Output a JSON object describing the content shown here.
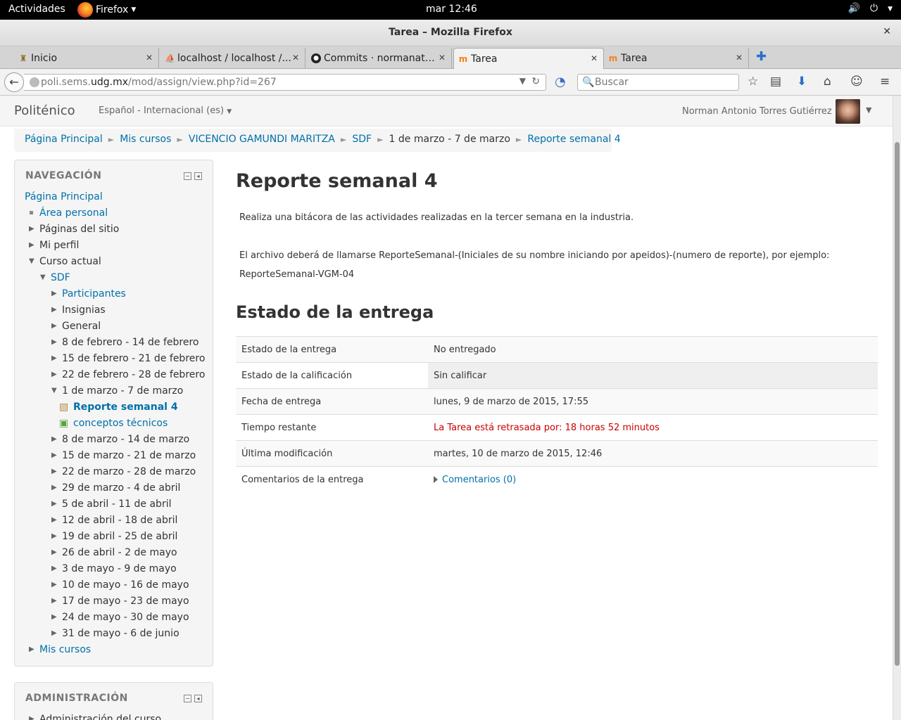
{
  "gnome": {
    "activities": "Actividades",
    "app": "Firefox",
    "clock": "mar 12:46"
  },
  "window": {
    "title": "Tarea – Mozilla Firefox"
  },
  "tabs": [
    {
      "label": "Inicio",
      "icon": "crest-icon"
    },
    {
      "label": "localhost / localhost /...",
      "icon": "phpmyadmin-icon"
    },
    {
      "label": "Commits · normanatg...",
      "icon": "github-icon"
    },
    {
      "label": "Tarea",
      "icon": "moodle-icon"
    },
    {
      "label": "Tarea",
      "icon": "moodle-icon"
    }
  ],
  "navbar": {
    "url_pre": "poli.sems.",
    "url_host": "udg.mx",
    "url_path": "/mod/assign/view.php?id=267",
    "search_placeholder": "Buscar"
  },
  "site": {
    "brand": "Politénico",
    "language": "Español - Internacional (es)",
    "user": "Norman Antonio Torres Gutiérrez"
  },
  "breadcrumb": [
    "Página Principal",
    "Mis cursos",
    "VICENCIO GAMUNDI MARITZA",
    "SDF",
    "1 de marzo - 7 de marzo",
    "Reporte semanal 4"
  ],
  "nav_block": {
    "title": "NAVEGACIÓN",
    "items": {
      "home": "Página Principal",
      "personal": "Área personal",
      "site_pages": "Páginas del sitio",
      "profile": "Mi perfil",
      "current": "Curso actual",
      "course": "SDF",
      "participants": "Participantes",
      "badges": "Insignias",
      "general": "General",
      "w1": "8 de febrero - 14 de febrero",
      "w2": "15 de febrero - 21 de febrero",
      "w3": "22 de febrero - 28 de febrero",
      "w4": "1 de marzo - 7 de marzo",
      "reporte": "Reporte semanal 4",
      "conceptos": "conceptos técnicos",
      "w5": "8 de marzo - 14 de marzo",
      "w6": "15 de marzo - 21 de marzo",
      "w7": "22 de marzo - 28 de marzo",
      "w8": "29 de marzo - 4 de abril",
      "w9": "5 de abril - 11 de abril",
      "w10": "12 de abril - 18 de abril",
      "w11": "19 de abril - 25 de abril",
      "w12": "26 de abril - 2 de mayo",
      "w13": "3 de mayo - 9 de mayo",
      "w14": "10 de mayo - 16 de mayo",
      "w15": "17 de mayo - 23 de mayo",
      "w16": "24 de mayo - 30 de mayo",
      "w17": "31 de mayo - 6 de junio",
      "my_courses": "Mis cursos"
    }
  },
  "admin_block": {
    "title": "ADMINISTRACIÓN",
    "first": "Administración del curso"
  },
  "assignment": {
    "title": "Reporte semanal 4",
    "desc1": "Realiza una bitácora de las actividades realizadas en la tercer semana en la industria.",
    "desc2": "El archivo deberá de llamarse ReporteSemanal-(Iniciales de su nombre iniciando por apeidos)-(numero de reporte), por ejemplo:",
    "desc3": "ReporteSemanal-VGM-04",
    "status_heading": "Estado de la entrega",
    "rows": [
      {
        "label": "Estado de la entrega",
        "value": "No entregado"
      },
      {
        "label": "Estado de la calificación",
        "value": "Sin calificar"
      },
      {
        "label": "Fecha de entrega",
        "value": "lunes, 9 de marzo de 2015, 17:55"
      },
      {
        "label": "Tiempo restante",
        "value": "La Tarea está retrasada por: 18 horas 52 minutos"
      },
      {
        "label": "Última modificación",
        "value": "martes, 10 de marzo de 2015, 12:46"
      },
      {
        "label": "Comentarios de la entrega",
        "value": "Comentarios (0)"
      }
    ]
  }
}
